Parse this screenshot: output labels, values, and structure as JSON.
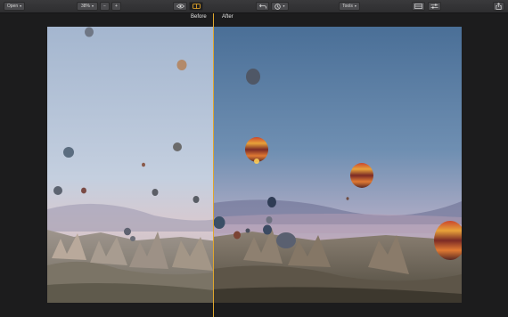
{
  "toolbar": {
    "open_label": "Open",
    "zoom_label": "38%",
    "zoom_out_label": "−",
    "zoom_in_label": "+",
    "tools_label": "Tools"
  },
  "compare": {
    "before_label": "Before",
    "after_label": "After"
  },
  "icons": {
    "eye": "eye-icon",
    "compare": "split-view-icon",
    "undo": "undo-icon",
    "history": "history-icon",
    "panel": "panel-icon",
    "sliders": "adjustments-icon",
    "share": "share-icon"
  },
  "colors": {
    "accent": "#f5b12a",
    "divider": "#e0a72e",
    "toolbar": "#353537",
    "background": "#1c1c1d"
  }
}
